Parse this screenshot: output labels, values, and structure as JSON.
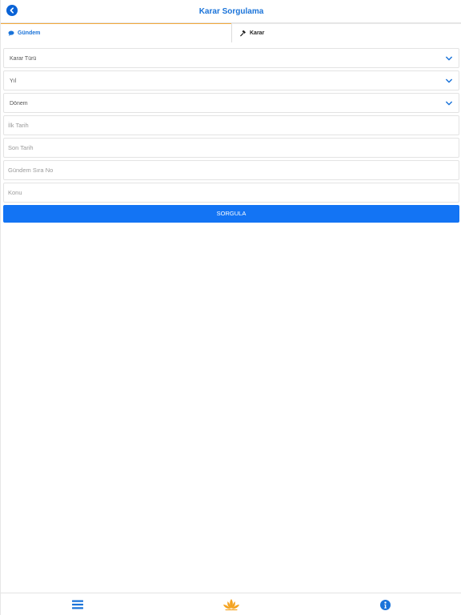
{
  "header": {
    "title": "Karar Sorgulama",
    "back_icon": "back-arrow-circle-icon"
  },
  "tabs": [
    {
      "label": "Gündem",
      "icon": "speech-bubble-icon",
      "active": true
    },
    {
      "label": "Karar",
      "icon": "gavel-icon",
      "active": false
    }
  ],
  "form": {
    "karar_turu": {
      "label": "Karar Türü",
      "icon": "chevron-down-icon"
    },
    "yil": {
      "label": "Yıl",
      "icon": "chevron-down-icon"
    },
    "donem": {
      "label": "Dönem",
      "icon": "chevron-down-icon"
    },
    "ilk_tarih": {
      "placeholder": "İlk Tarih",
      "value": ""
    },
    "son_tarih": {
      "placeholder": "Son Tarih",
      "value": ""
    },
    "gundem_sira_no": {
      "placeholder": "Gündem Sıra No",
      "value": ""
    },
    "konu": {
      "placeholder": "Konu",
      "value": ""
    },
    "submit_label": "SORGULA"
  },
  "bottom_nav": {
    "menu_icon": "hamburger-menu-icon",
    "logo_icon": "lotus-logo-icon",
    "info_icon": "info-circle-icon"
  },
  "colors": {
    "accent_blue": "#1a73d9",
    "button_blue": "#1374f4",
    "tab_indicator": "#f4a93a",
    "logo_orange": "#f4a320"
  }
}
